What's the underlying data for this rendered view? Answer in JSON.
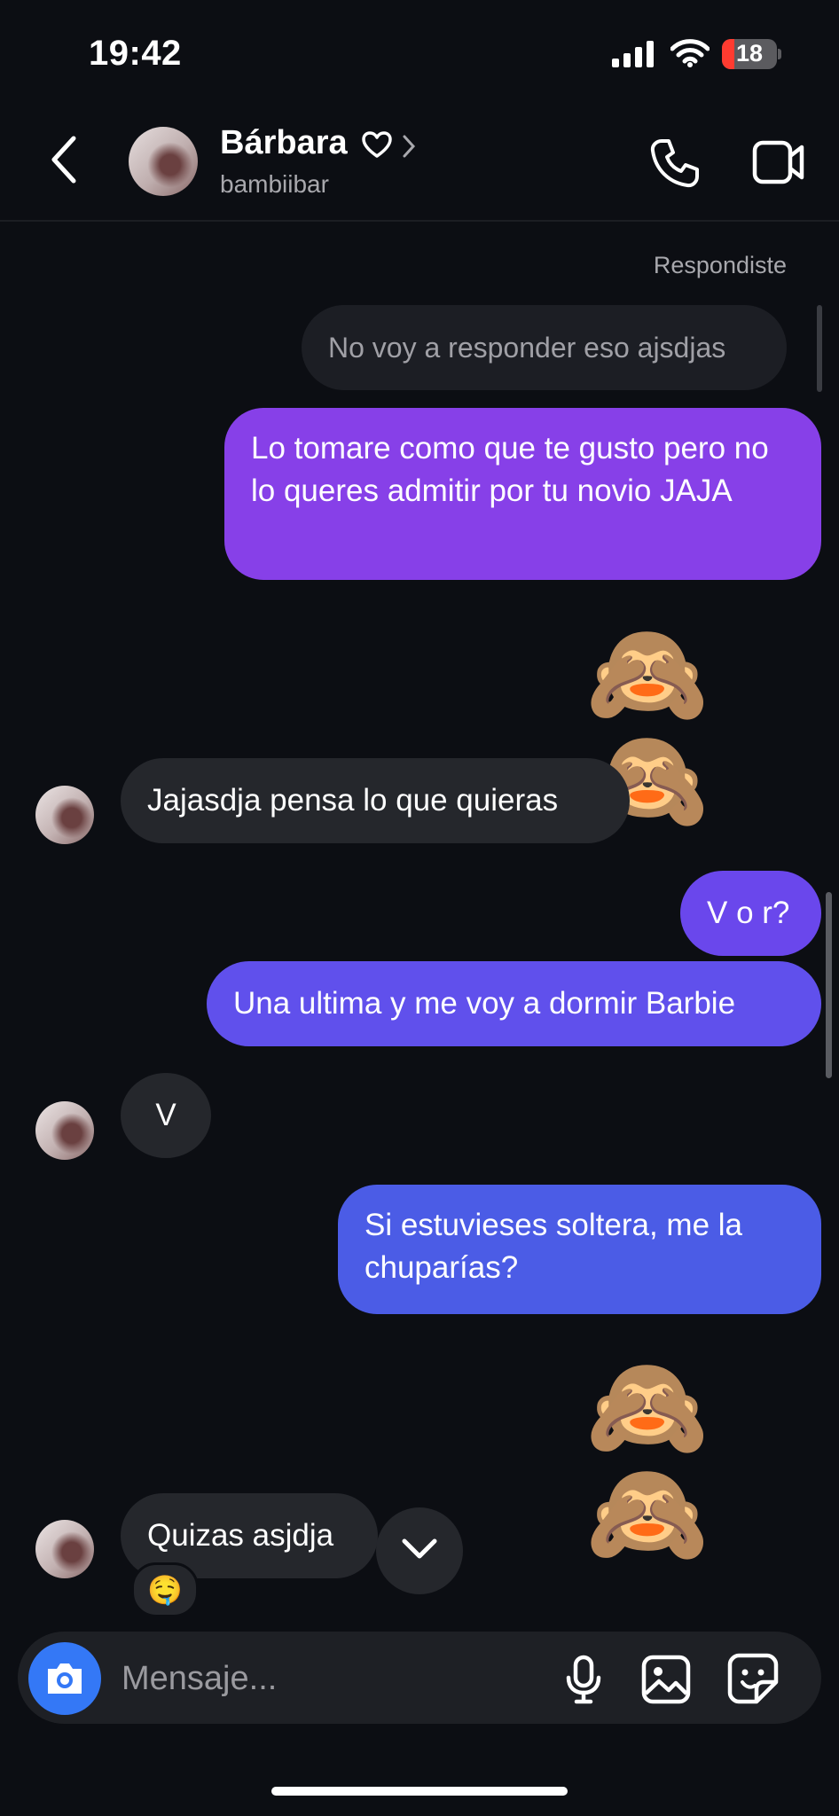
{
  "status_bar": {
    "time": "19:42",
    "battery_level": "18"
  },
  "header": {
    "name": "Bárbara",
    "username": "bambiibar",
    "icons": [
      "back-arrow-icon",
      "heart-icon",
      "chevron-right-icon",
      "phone-icon",
      "video-camera-icon"
    ]
  },
  "thread": {
    "replied_label": "Respondiste",
    "reply_quote": "No voy a responder eso ajsdjas",
    "sent_1": "Lo tomare como que te gusto pero no lo queres admitir por tu novio JAJA",
    "emoji_1": "🙈 🙈",
    "received_1": "Jajasdja pensa lo que quieras",
    "sent_2": "V o r?",
    "sent_3": "Una ultima y me voy a dormir Barbie",
    "received_2": "V",
    "sent_4": "Si estuvieses soltera, me la chuparías?",
    "emoji_2": "🙈 🙈",
    "received_3": "Quizas asjdja",
    "reaction": "🤤"
  },
  "composer": {
    "placeholder": "Mensaje...",
    "icons": [
      "camera-icon",
      "microphone-icon",
      "gallery-icon",
      "sticker-icon"
    ]
  },
  "colors": {
    "background": "#0c0e13",
    "received_bubble": "#25272c",
    "sent_gradient_top": "#8740e8",
    "sent_gradient_bottom": "#4b5ce6",
    "camera_button": "#3478f6"
  }
}
